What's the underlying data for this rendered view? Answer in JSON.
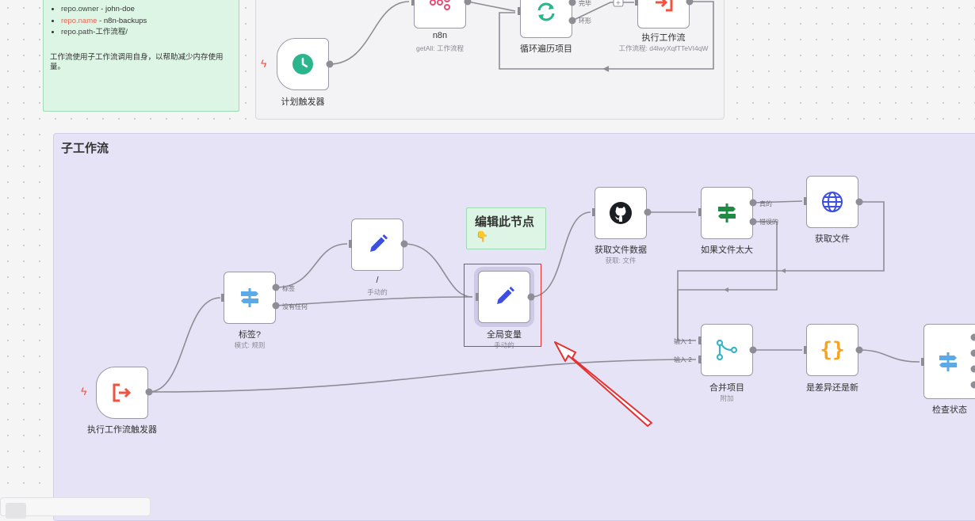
{
  "notes": {
    "top_left": {
      "items": [
        {
          "key": "repo.owner",
          "sep": " - ",
          "value": "john-doe",
          "key_color": "#444444"
        },
        {
          "key": "repo.name",
          "sep": " - ",
          "value": "n8n-backups",
          "key_color": "#e8665a"
        },
        {
          "key": "repo.path",
          "sep": "-",
          "value": "工作流程/",
          "key_color": "#444444"
        }
      ],
      "description": "工作流使用子工作流调用自身，以帮助减少内存使用量。"
    },
    "edit_hint": {
      "title": "编辑此节点",
      "emoji": "👇"
    }
  },
  "groups": {
    "sub_workflow_title": "子工作流"
  },
  "nodes": {
    "schedule_trigger": {
      "label": "计划触发器"
    },
    "n8n": {
      "label": "n8n",
      "subtitle": "getAll: 工作流程"
    },
    "loop": {
      "label": "循环遍历项目",
      "port_done": "完毕",
      "port_loop": "环形"
    },
    "execute_workflow": {
      "label": "执行工作流",
      "subtitle": "工作流程: d4lwyXqfTTeVI4qW"
    },
    "exec_trigger": {
      "label": "执行工作流触发器"
    },
    "tag_switch": {
      "label": "标签?",
      "subtitle": "模式: 规则",
      "port_tag": "标签",
      "port_none": "没有任何"
    },
    "slash_set": {
      "label": "/",
      "subtitle": "手动的"
    },
    "global_vars": {
      "label": "全局变量",
      "subtitle": "手动的"
    },
    "get_file_data": {
      "label": "获取文件数据",
      "subtitle": "获取: 文件"
    },
    "if_file_large": {
      "label": "如果文件太大",
      "port_true": "真的",
      "port_false": "错误的"
    },
    "get_file": {
      "label": "获取文件"
    },
    "merge": {
      "label": "合并项目",
      "subtitle": "附加",
      "in1": "输入 1",
      "in2": "输入 2"
    },
    "diff_check": {
      "label": "是差异还是新"
    },
    "check_status": {
      "label": "检查状态"
    }
  },
  "colors": {
    "edge": "#8d8d96",
    "selection": "#e43232",
    "group_purple": "#e7e3f6",
    "sticky_green": "#dcf5e4"
  }
}
